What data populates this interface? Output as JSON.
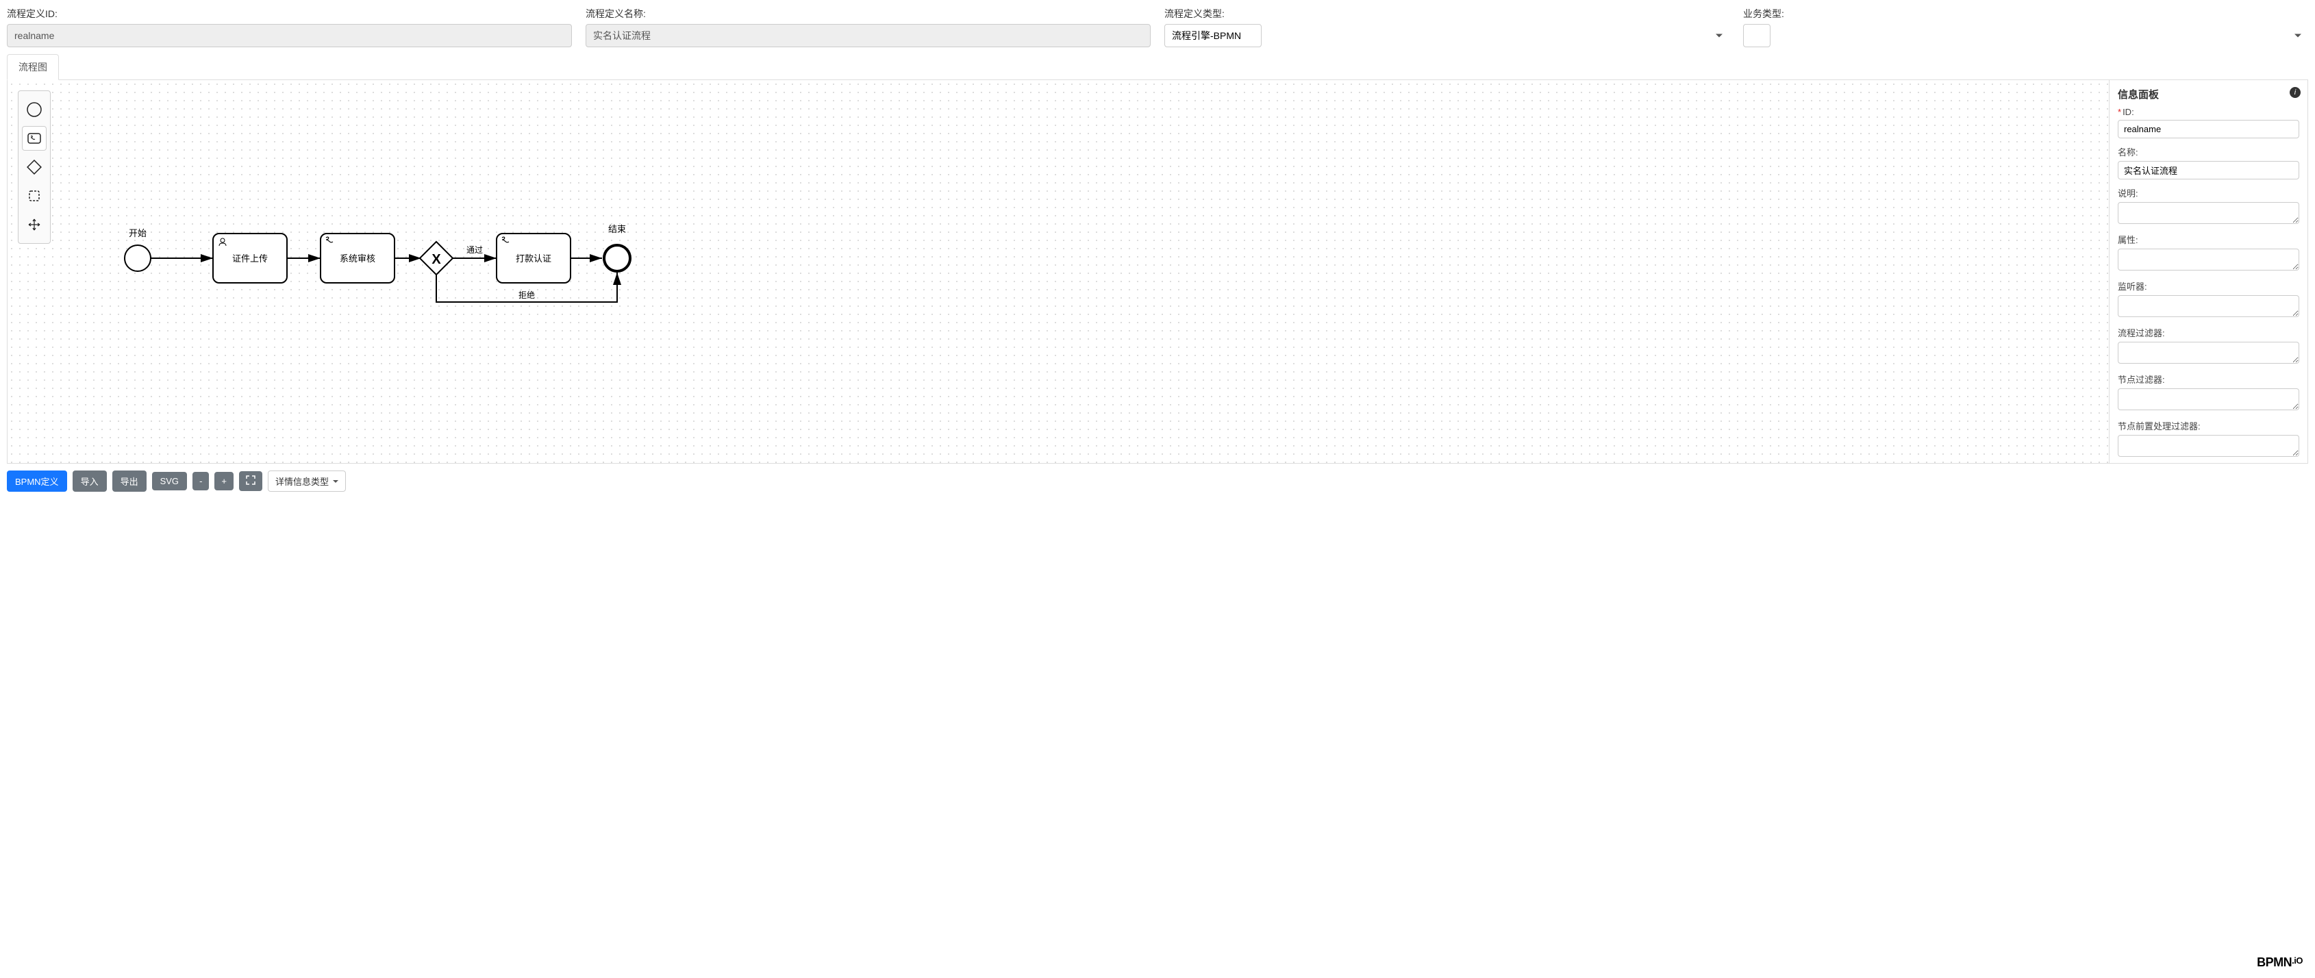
{
  "header": {
    "fields": {
      "id_label": "流程定义ID:",
      "id_value": "realname",
      "name_label": "流程定义名称:",
      "name_value": "实名认证流程",
      "type_label": "流程定义类型:",
      "type_value": "流程引擎-BPMN",
      "biz_label": "业务类型:",
      "biz_value": ""
    }
  },
  "tabs": {
    "flow": "流程图"
  },
  "palette": {
    "items": [
      "start-event",
      "service-task",
      "gateway",
      "lasso-tool",
      "space-tool"
    ]
  },
  "diagram": {
    "nodes": {
      "start": {
        "label": "开始"
      },
      "upload": {
        "label": "证件上传"
      },
      "review": {
        "label": "系统审核"
      },
      "gateway": {
        "label": ""
      },
      "payment": {
        "label": "打款认证"
      },
      "end": {
        "label": "结束"
      }
    },
    "edges": {
      "pass": "通过",
      "reject": "拒绝"
    }
  },
  "info_panel": {
    "title": "信息面板",
    "fields": {
      "id_label": "ID:",
      "id_value": "realname",
      "name_label": "名称:",
      "name_value": "实名认证流程",
      "desc_label": "说明:",
      "desc_value": "",
      "attr_label": "属性:",
      "attr_value": "",
      "listener_label": "监听器:",
      "listener_value": "",
      "flow_filter_label": "流程过滤器:",
      "flow_filter_value": "",
      "node_filter_label": "节点过滤器:",
      "node_filter_value": "",
      "node_pre_filter_label": "节点前置处理过滤器:",
      "node_pre_filter_value": ""
    }
  },
  "toolbar": {
    "bpmn_def": "BPMN定义",
    "import": "导入",
    "export": "导出",
    "svg": "SVG",
    "zoom_out": "-",
    "zoom_in": "+",
    "fullscreen": "⛶",
    "detail_type": "详情信息类型"
  },
  "logo": {
    "brand": "BPMN",
    "suffix": ".iO"
  }
}
